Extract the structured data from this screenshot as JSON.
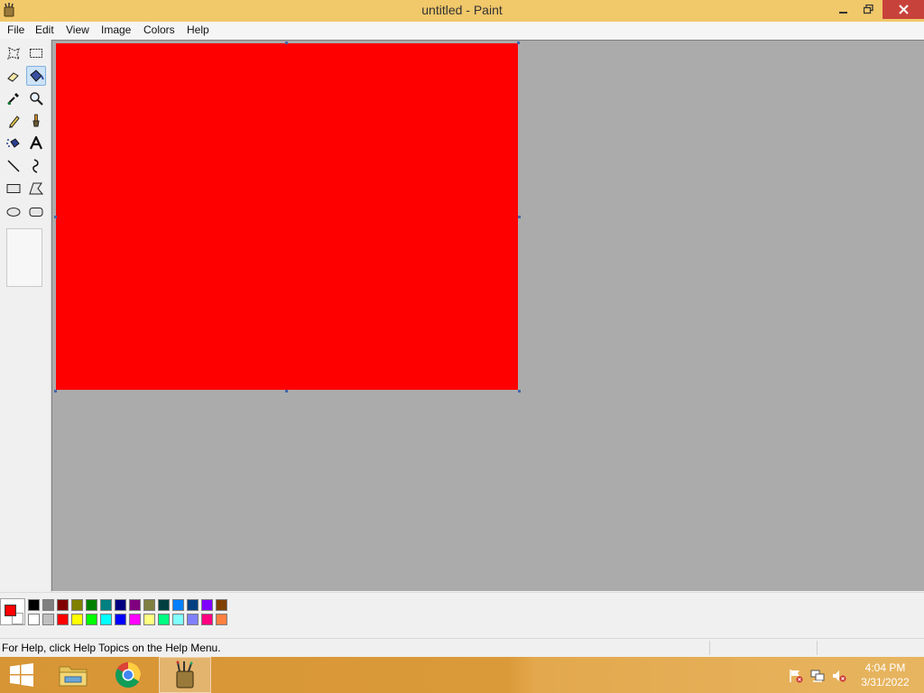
{
  "window": {
    "title": "untitled - Paint",
    "minimize_icon": "minimize-icon",
    "maximize_icon": "restore-icon",
    "close_icon": "close-icon"
  },
  "menu": [
    "File",
    "Edit",
    "View",
    "Image",
    "Colors",
    "Help"
  ],
  "tools": [
    {
      "name": "free-form-select",
      "icon": "free-form-select-icon"
    },
    {
      "name": "select",
      "icon": "rect-select-icon"
    },
    {
      "name": "eraser",
      "icon": "eraser-icon"
    },
    {
      "name": "fill-with-color",
      "icon": "paint-bucket-icon",
      "active": true
    },
    {
      "name": "pick-color",
      "icon": "eyedropper-icon"
    },
    {
      "name": "magnifier",
      "icon": "magnifier-icon"
    },
    {
      "name": "pencil",
      "icon": "pencil-icon"
    },
    {
      "name": "brush",
      "icon": "brush-icon"
    },
    {
      "name": "airbrush",
      "icon": "airbrush-icon"
    },
    {
      "name": "text",
      "icon": "text-icon"
    },
    {
      "name": "line",
      "icon": "line-icon"
    },
    {
      "name": "curve",
      "icon": "curve-icon"
    },
    {
      "name": "rectangle",
      "icon": "rectangle-icon"
    },
    {
      "name": "polygon",
      "icon": "polygon-icon"
    },
    {
      "name": "ellipse",
      "icon": "ellipse-icon"
    },
    {
      "name": "rounded-rectangle",
      "icon": "rounded-rectangle-icon"
    }
  ],
  "canvas": {
    "fill_color": "#ff0000",
    "workspace_color": "#ababab"
  },
  "colors": {
    "foreground": "#ff0000",
    "background": "#ffffff",
    "palette_top": [
      "#000000",
      "#808080",
      "#800000",
      "#808000",
      "#008000",
      "#008080",
      "#000080",
      "#800080",
      "#808040",
      "#004040",
      "#0080ff",
      "#004080",
      "#8000ff",
      "#804000"
    ],
    "palette_bottom": [
      "#ffffff",
      "#c0c0c0",
      "#ff0000",
      "#ffff00",
      "#00ff00",
      "#00ffff",
      "#0000ff",
      "#ff00ff",
      "#ffff80",
      "#00ff80",
      "#80ffff",
      "#8080ff",
      "#ff0080",
      "#ff8040"
    ]
  },
  "status": {
    "help_text": "For Help, click Help Topics on the Help Menu."
  },
  "taskbar": {
    "start_icon": "windows-logo-icon",
    "apps": [
      {
        "name": "file-explorer",
        "icon": "folder-icon"
      },
      {
        "name": "chrome",
        "icon": "chrome-icon"
      },
      {
        "name": "paint",
        "icon": "paint-icon",
        "active": true
      }
    ],
    "tray": [
      "action-center-flag-icon",
      "network-icon",
      "volume-muted-icon"
    ],
    "time": "4:04 PM",
    "date": "3/31/2022"
  }
}
